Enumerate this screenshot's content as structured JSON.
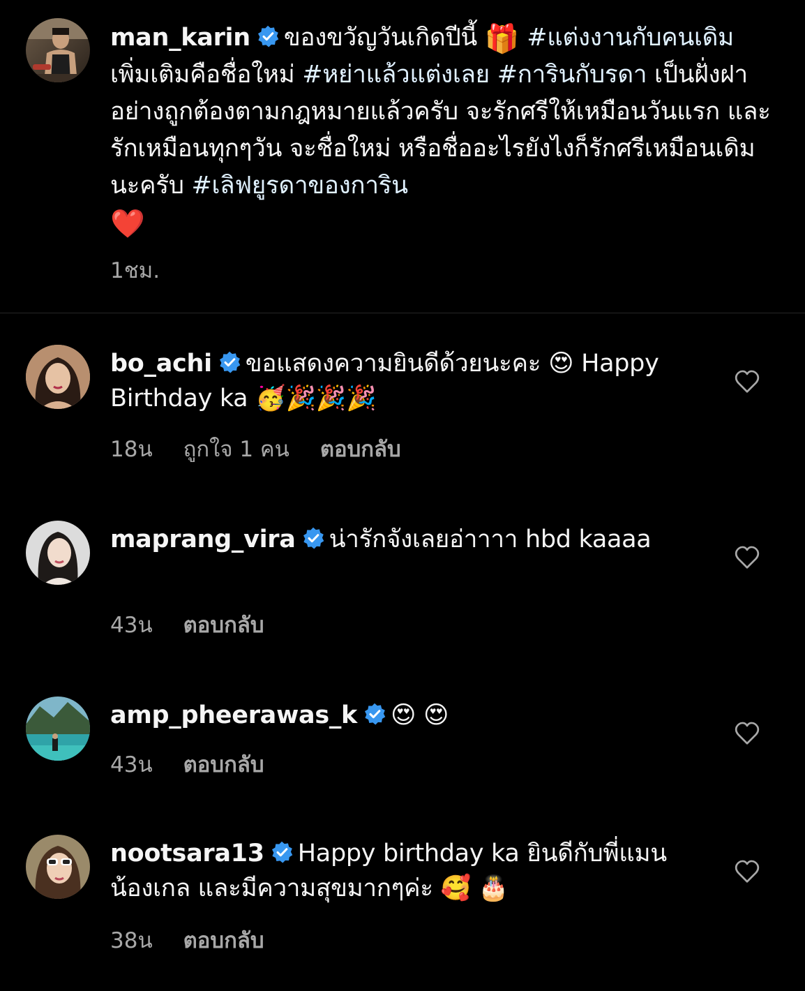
{
  "post": {
    "username": "man_karin",
    "text_1": "ของขวัญวันเกิดปีนี้ ",
    "emoji_gift": "🎁",
    "text_2": " ",
    "hashtag_1": "#แต่งงานกับคนเดิม",
    "text_3": " เพิ่มเติมคือชื่อใหม่ ",
    "hashtag_2": "#หย่าแล้วแต่งเลย",
    "text_4": " ",
    "hashtag_3": "#การินกับรดา",
    "text_5": " เป็นฝั่งฝาอย่างถูกต้องตามกฎหมายแล้วครับ จะรักศรีให้เหมือนวันแรก และรักเหมือนทุกๆวัน จะชื่อใหม่ หรือชื่ออะไรยังไงก็รักศรีเหมือนเดิมนะครับ ",
    "hashtag_4": "#เลิฟยูรดาของการิน",
    "emoji_heart": "❤️",
    "time": "1ชม."
  },
  "comments": [
    {
      "username": "bo_achi",
      "text": "ขอแสดงความยินดีด้วยนะคะ 😍 Happy Birthday ka 🥳🎉🎉🎉",
      "time": "18น",
      "likes": "ถูกใจ 1 คน",
      "reply": "ตอบกลับ"
    },
    {
      "username": "maprang_vira",
      "text": "น่ารักจังเลยอ่าาาา hbd kaaaa",
      "time": "43น",
      "reply": "ตอบกลับ"
    },
    {
      "username": "amp_pheerawas_k",
      "text": "😍 😍",
      "time": "43น",
      "reply": "ตอบกลับ"
    },
    {
      "username": "nootsara13",
      "text": "Happy birthday ka ยินดีกับพี่แมน น้องเกล และมีความสุขมากๆค่ะ 🥰 🎂",
      "time": "38น",
      "reply": "ตอบกลับ"
    }
  ],
  "icons": {
    "verified": "verified-badge-icon",
    "like": "heart-outline-icon"
  },
  "colors": {
    "background": "#000000",
    "text": "#f5f5f5",
    "secondary": "#a8a8a8",
    "verified": "#3897f0",
    "hashtag": "#e0f1ff",
    "divider": "#262626"
  }
}
